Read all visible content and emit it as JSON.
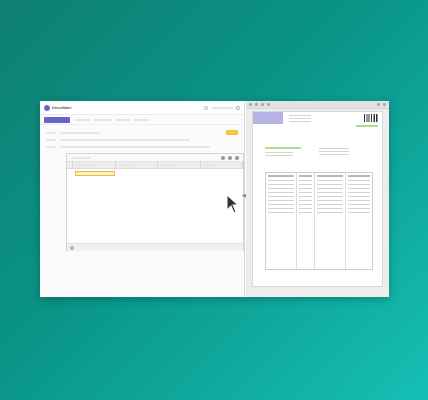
{
  "app": {
    "brand": "DocuWare",
    "primary_button": "",
    "colors": {
      "accent": "#6a64c9",
      "warning": "#f5c440",
      "selection": "#fdeec3",
      "doc_header": "#b7b3e3",
      "doc_highlight": "#a7df8a"
    }
  },
  "icons": [
    "logo-icon",
    "bell-icon",
    "user-icon",
    "mouse-pointer-icon",
    "barcode-icon",
    "splitter-arrow-icon"
  ]
}
